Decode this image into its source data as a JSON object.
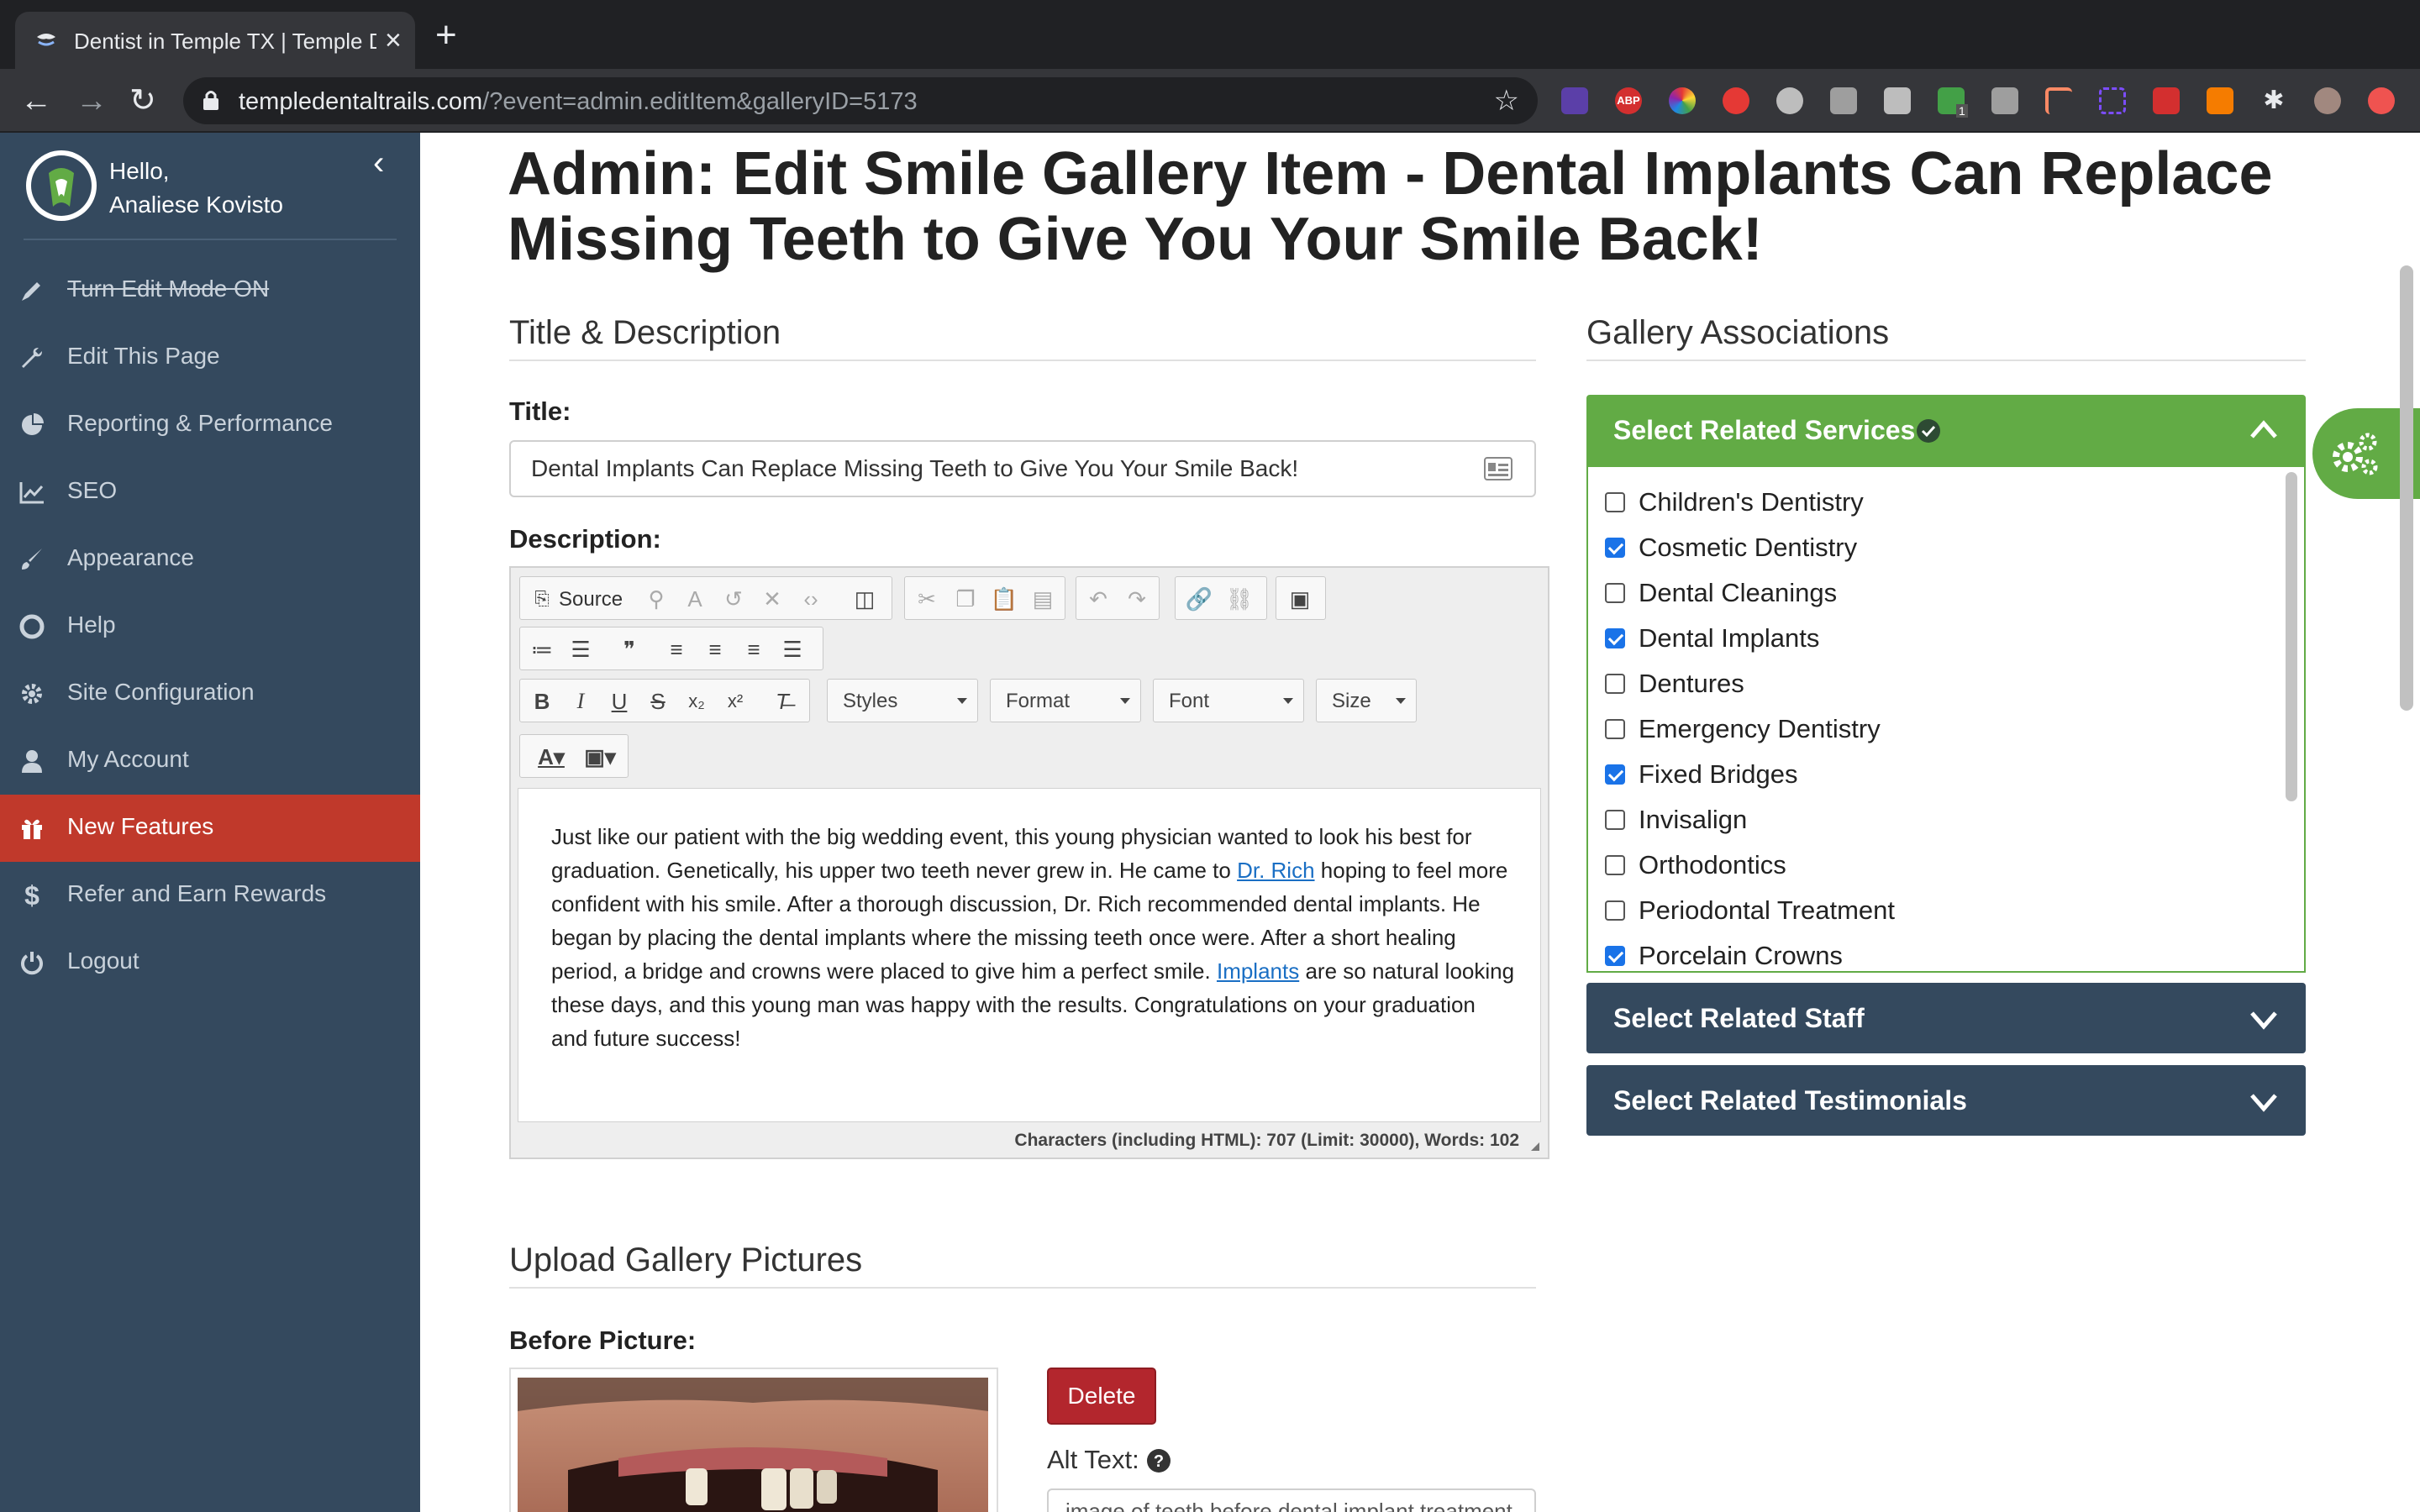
{
  "browser": {
    "tab_title": "Dentist in Temple TX | Temple Dental Trails",
    "url_host": "templedentaltrails.com",
    "url_path": "/?event=admin.editItem&galleryID=5173",
    "ext_abp": "ABP",
    "ext_badge": "1"
  },
  "sidebar": {
    "greeting": "Hello,",
    "user_name": "Analiese Kovisto",
    "items": [
      {
        "label": "Turn Edit Mode ON",
        "icon": "pencil-icon"
      },
      {
        "label": "Edit This Page",
        "icon": "wrench-icon"
      },
      {
        "label": "Reporting & Performance",
        "icon": "pie-chart-icon"
      },
      {
        "label": "SEO",
        "icon": "line-chart-icon"
      },
      {
        "label": "Appearance",
        "icon": "paintbrush-icon"
      },
      {
        "label": "Help",
        "icon": "lifebuoy-icon"
      },
      {
        "label": "Site Configuration",
        "icon": "gear-icon"
      },
      {
        "label": "My Account",
        "icon": "user-icon"
      },
      {
        "label": "New Features",
        "icon": "gift-icon"
      },
      {
        "label": "Refer and Earn Rewards",
        "icon": "dollar-icon"
      },
      {
        "label": "Logout",
        "icon": "power-icon"
      }
    ]
  },
  "main": {
    "page_title": "Admin: Edit Smile Gallery Item - Dental Implants Can Replace Missing Teeth to Give You Your Smile Back!",
    "title_section": "Title & Description",
    "title_label": "Title:",
    "title_value": "Dental Implants Can Replace Missing Teeth to Give You Your Smile Back!",
    "description_label": "Description:",
    "editor": {
      "source_label": "Source",
      "styles": "Styles",
      "format": "Format",
      "font": "Font",
      "size": "Size",
      "body_1": "Just like our patient with the big wedding event, this young physician wanted to look his best for graduation. Genetically, his upper two teeth never grew in. He came to ",
      "link_1": "Dr. Rich",
      "body_2": " hoping to feel more confident with his smile. After a thorough discussion, Dr. Rich recommended dental implants. He began by placing the dental implants where the missing teeth once were. After a short healing period, a bridge and crowns were placed to give him a perfect smile. ",
      "link_2": "Implants",
      "body_3": " are so natural looking these days, and this young man was happy with the results. Congratulations on your graduation and future success!",
      "char_count": "Characters (including HTML): 707 (Limit: 30000), Words: 102"
    },
    "gallery_section": "Gallery Associations",
    "services_header": "Select Related Services",
    "services": [
      {
        "label": "Children's Dentistry",
        "checked": false
      },
      {
        "label": "Cosmetic Dentistry",
        "checked": true
      },
      {
        "label": "Dental Cleanings",
        "checked": false
      },
      {
        "label": "Dental Implants",
        "checked": true
      },
      {
        "label": "Dentures",
        "checked": false
      },
      {
        "label": "Emergency Dentistry",
        "checked": false
      },
      {
        "label": "Fixed Bridges",
        "checked": true
      },
      {
        "label": "Invisalign",
        "checked": false
      },
      {
        "label": "Orthodontics",
        "checked": false
      },
      {
        "label": "Periodontal Treatment",
        "checked": false
      },
      {
        "label": "Porcelain Crowns",
        "checked": true
      }
    ],
    "staff_header": "Select Related Staff",
    "testimonials_header": "Select Related Testimonials",
    "upload_section": "Upload Gallery Pictures",
    "before_label": "Before Picture:",
    "delete_label": "Delete",
    "alt_text_label": "Alt Text:",
    "alt_text_value": "image of teeth before dental implant treatment"
  },
  "colors": {
    "sidebar_bg": "#34495e",
    "active_red": "#c0392b",
    "services_green": "#62ab45",
    "delete_red": "#b3262d"
  }
}
